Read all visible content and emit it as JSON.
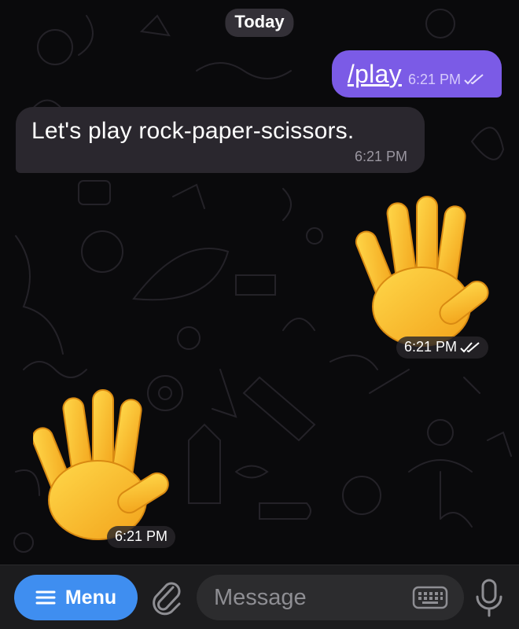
{
  "date_separator": "Today",
  "messages": [
    {
      "direction": "outgoing",
      "text": "/play",
      "time": "6:21 PM",
      "status": "read"
    },
    {
      "direction": "incoming",
      "text": "Let's play rock-paper-scissors.",
      "time": "6:21 PM"
    },
    {
      "direction": "outgoing",
      "sticker": "raised-hand-emoji",
      "time": "6:21 PM",
      "status": "read"
    },
    {
      "direction": "incoming",
      "sticker": "raised-hand-emoji",
      "time": "6:21 PM"
    }
  ],
  "input_bar": {
    "menu_label": "Menu",
    "message_placeholder": "Message",
    "icons": [
      "menu-icon",
      "paperclip-icon",
      "keyboard-icon",
      "microphone-icon"
    ]
  },
  "colors": {
    "outgoing_bubble": "#7b5be6",
    "incoming_bubble": "#2a272e",
    "menu_button": "#3f8ef0",
    "background": "#0a0a0c"
  }
}
